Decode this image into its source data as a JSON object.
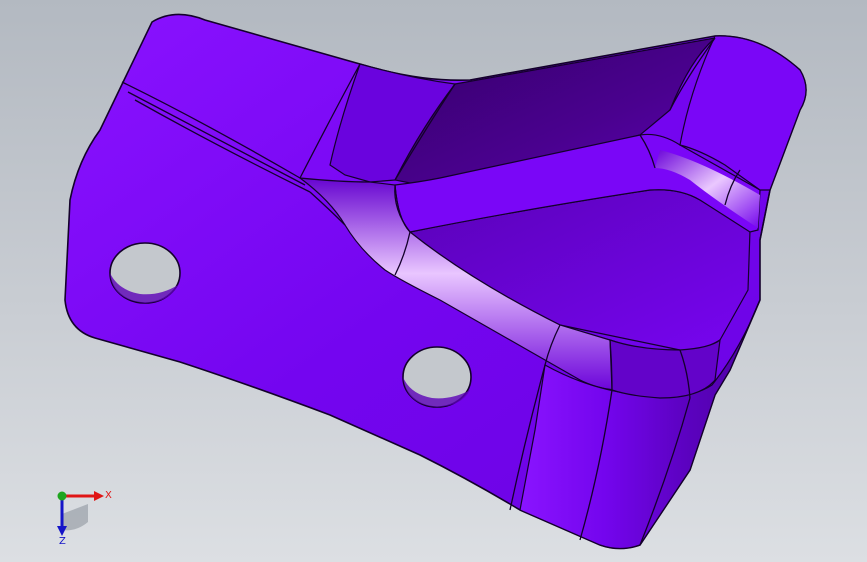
{
  "viewport": {
    "background_top": "#b3b9c1",
    "background_bottom": "#dcdfe3"
  },
  "model": {
    "part": "sheet-metal-bracket",
    "face_color": "#7a06f7",
    "shadow_color": "#3f0277",
    "edge_color": "#14012b",
    "highlight_color": "#f3d8ff",
    "hole_color": "#c6cacf"
  },
  "triad": {
    "x_label": "X",
    "z_label": "Z",
    "x_color": "#e01515",
    "y_color": "#1fa51f",
    "z_color": "#1414c8"
  }
}
